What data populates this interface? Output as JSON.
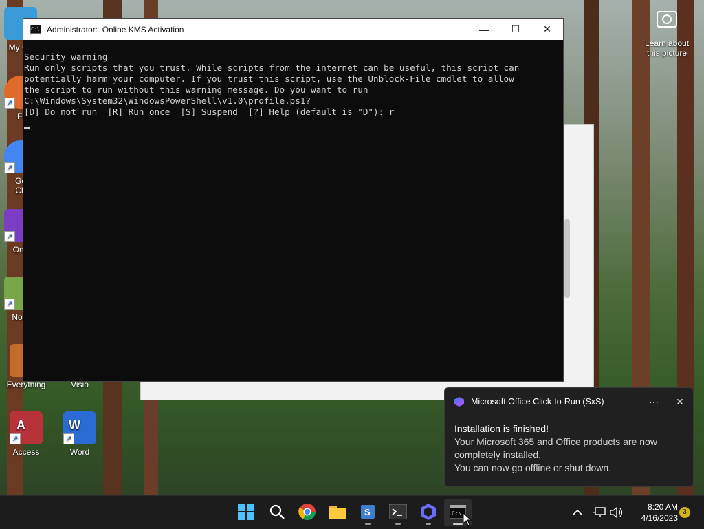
{
  "desktop": {
    "icons": [
      {
        "label": "My Co",
        "color": "#3a9bd8"
      },
      {
        "label": "Fi",
        "color": "#e06a2a"
      },
      {
        "label": "Go\nCh",
        "color": "#4285f4"
      },
      {
        "label": "One",
        "color": "#7b3ec2"
      },
      {
        "label": "Note",
        "color": "#7aa64a"
      },
      {
        "label": "Everything",
        "color": "#c46a2a"
      },
      {
        "label": "Visio",
        "color": "#3b5fb5"
      },
      {
        "label": "Access",
        "color": "#b8323a"
      },
      {
        "label": "Word",
        "color": "#2b6bd4"
      }
    ],
    "spotlight_label": "Learn about this picture"
  },
  "console": {
    "title_prefix": "Administrator:",
    "title": "Online KMS Activation",
    "lines": [
      "Security warning",
      "Run only scripts that you trust. While scripts from the internet can be useful, this script can",
      "potentially harm your computer. If you trust this script, use the Unblock-File cmdlet to allow",
      "the script to run without this warning message. Do you want to run",
      "C:\\Windows\\System32\\WindowsPowerShell\\v1.0\\profile.ps1?",
      "[D] Do not run  [R] Run once  [S] Suspend  [?] Help (default is \"D\"): r"
    ],
    "minimize_glyph": "—",
    "maximize_glyph": "☐",
    "close_glyph": "✕"
  },
  "toast": {
    "app_name": "Microsoft Office Click-to-Run (SxS)",
    "more_glyph": "···",
    "close_glyph": "✕",
    "heading": "Installation is finished!",
    "line1": "Your Microsoft 365 and Office products are now completely installed.",
    "line2": "You can now go offline or shut down."
  },
  "taskbar": {
    "apps": [
      {
        "name": "start-icon"
      },
      {
        "name": "search-icon"
      },
      {
        "name": "chrome-icon"
      },
      {
        "name": "file-explorer-icon"
      },
      {
        "name": "teams-admin-icon"
      },
      {
        "name": "terminal-icon"
      },
      {
        "name": "copilot-icon"
      },
      {
        "name": "console-icon"
      }
    ],
    "tray_chevron": "^",
    "time": "8:20 AM",
    "date": "4/16/2023",
    "notification_count": "3"
  }
}
